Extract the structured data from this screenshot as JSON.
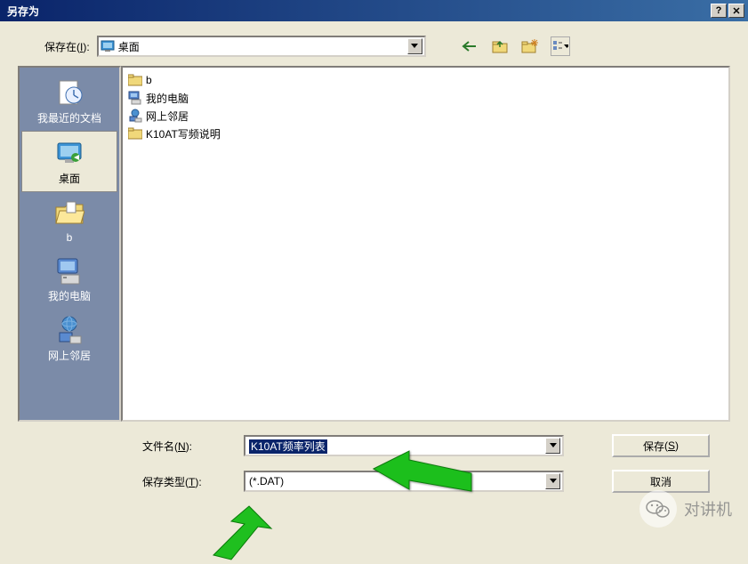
{
  "title": "另存为",
  "lookin": {
    "label": "保存在",
    "accel": "I",
    "value": "桌面"
  },
  "toolbar": {
    "back": "后退",
    "up": "上一级",
    "new_folder": "新建文件夹",
    "views": "查看"
  },
  "places": [
    {
      "label": "我最近的文档",
      "icon": "recent"
    },
    {
      "label": "桌面",
      "icon": "desktop",
      "selected": true
    },
    {
      "label": "b",
      "icon": "folder-open"
    },
    {
      "label": "我的电脑",
      "icon": "computer"
    },
    {
      "label": "网上邻居",
      "icon": "network"
    }
  ],
  "files": [
    {
      "name": "b",
      "icon": "folder"
    },
    {
      "name": "我的电脑",
      "icon": "computer"
    },
    {
      "name": "网上邻居",
      "icon": "network"
    },
    {
      "name": "K10AT写频说明",
      "icon": "folder"
    }
  ],
  "filename": {
    "label": "文件名",
    "accel": "N",
    "value": "K10AT频率列表"
  },
  "filetype": {
    "label": "保存类型",
    "accel": "T",
    "value": "(*.DAT)"
  },
  "buttons": {
    "save": "保存",
    "save_accel": "S",
    "cancel": "取消"
  },
  "watermark": "对讲机"
}
